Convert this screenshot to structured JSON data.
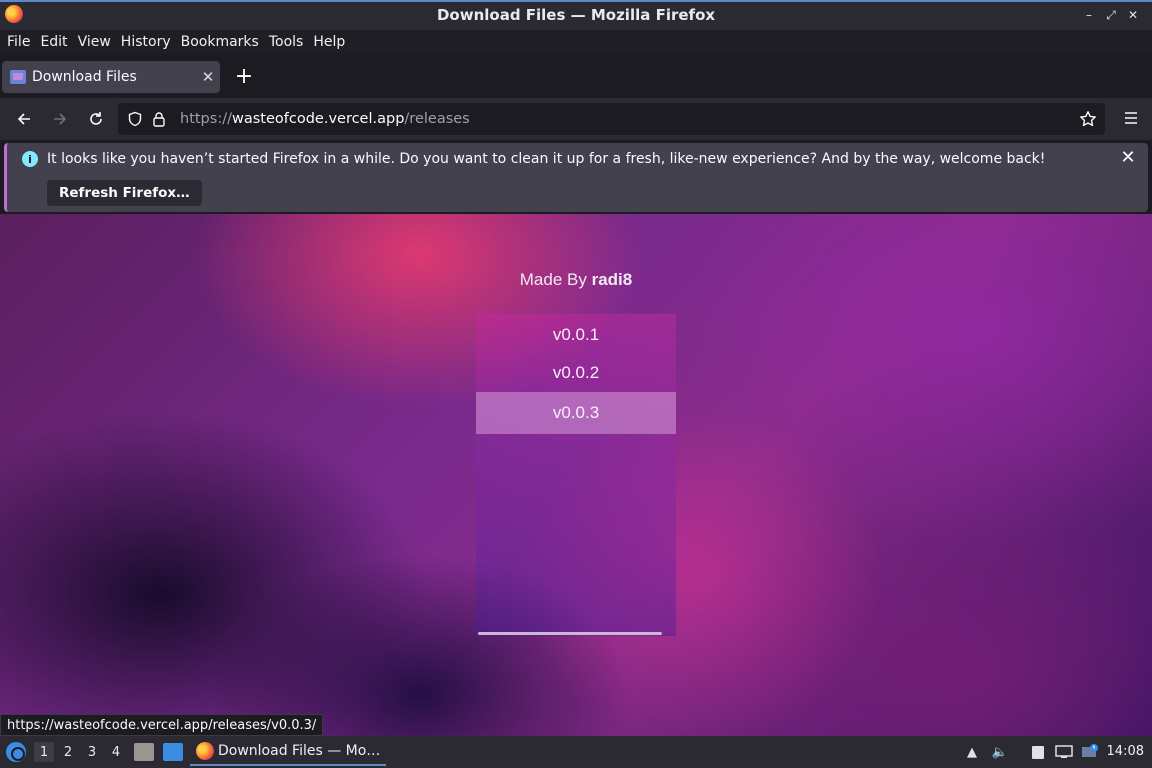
{
  "window": {
    "title": "Download Files — Mozilla Firefox"
  },
  "menubar": [
    "File",
    "Edit",
    "View",
    "History",
    "Bookmarks",
    "Tools",
    "Help"
  ],
  "tabs": [
    {
      "label": "Download Files"
    }
  ],
  "urlbar": {
    "protocol": "https://",
    "host": "wasteofcode.vercel.app",
    "path": "/releases"
  },
  "notification": {
    "message": "It looks like you haven’t started Firefox in a while. Do you want to clean it up for a fresh, like-new experience? And by the way, welcome back!",
    "button": "Refresh Firefox…"
  },
  "page": {
    "made_by_prefix": "Made By",
    "made_by_name": "radi8",
    "releases": [
      "v0.0.1",
      "v0.0.2",
      "v0.0.3"
    ],
    "hovered_release": "v0.0.3"
  },
  "status_link": "https://wasteofcode.vercel.app/releases/v0.0.3/",
  "taskbar": {
    "workspaces": [
      "1",
      "2",
      "3",
      "4"
    ],
    "active_workspace": "1",
    "task_label": "Download Files — Mo…",
    "clock": "14:08"
  },
  "colors": {
    "accent": "#5e88c6",
    "notification_border": "#c06bd7",
    "info_icon": "#80ebff"
  }
}
